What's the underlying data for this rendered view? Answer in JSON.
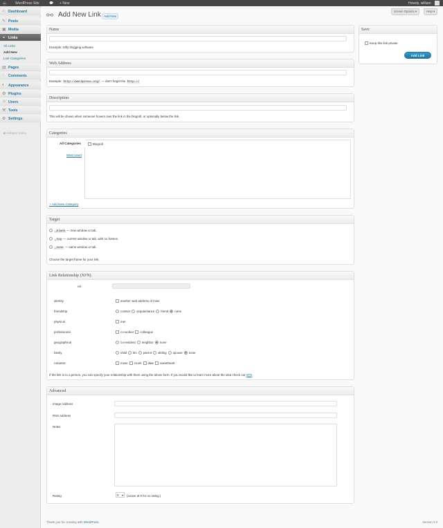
{
  "admin_bar": {
    "site_name": "WordPress Site",
    "comments_count": "",
    "new_label": "New",
    "howdy": "Howdy, william"
  },
  "sidebar": {
    "items": [
      {
        "label": "Dashboard"
      },
      {
        "label": "Posts"
      },
      {
        "label": "Media"
      },
      {
        "label": "Links"
      },
      {
        "label": "Pages"
      },
      {
        "label": "Comments"
      },
      {
        "label": "Appearance"
      },
      {
        "label": "Plugins"
      },
      {
        "label": "Users"
      },
      {
        "label": "Tools"
      },
      {
        "label": "Settings"
      }
    ],
    "links_sub": [
      "All Links",
      "Add New",
      "Link Categories"
    ],
    "collapse": "Collapse menu"
  },
  "header": {
    "title": "Add New Link",
    "add_new": "Add New",
    "screen_options": "Screen Options",
    "help": "Help"
  },
  "name_box": {
    "title": "Name",
    "value": "",
    "hint": "Example: Nifty blogging software"
  },
  "web_box": {
    "title": "Web Address",
    "value": "",
    "hint_pre": "Example:",
    "hint_code1": "http://wordpress.org/",
    "hint_mid": "— don't forget the",
    "hint_code2": "http://"
  },
  "desc_box": {
    "title": "Description",
    "value": "",
    "hint": "This will be shown when someone hovers over the link in the blogroll, or optionally below the link."
  },
  "categories": {
    "title": "Categories",
    "tab_all": "All Categories",
    "tab_most": "Most Used",
    "item": "Blogroll",
    "add": "+ Add New Category"
  },
  "target": {
    "title": "Target",
    "options": [
      {
        "code": "_blank",
        "text": "— new window or tab."
      },
      {
        "code": "_top",
        "text": "— current window or tab, with no frames."
      },
      {
        "code": "_none",
        "text": "— same window or tab."
      }
    ],
    "hint": "Choose the target frame for your link."
  },
  "xfn": {
    "title": "Link Relationship (XFN)",
    "rel_label": "rel:",
    "rel_value": "",
    "rows": [
      {
        "label": "identity",
        "opts": [
          {
            "t": "another web address of mine",
            "k": "cb"
          }
        ]
      },
      {
        "label": "friendship",
        "opts": [
          {
            "t": "contact",
            "k": "rd"
          },
          {
            "t": "acquaintance",
            "k": "rd"
          },
          {
            "t": "friend",
            "k": "rd"
          },
          {
            "t": "none",
            "k": "rd",
            "on": true
          }
        ]
      },
      {
        "label": "physical",
        "opts": [
          {
            "t": "met",
            "k": "cb"
          }
        ]
      },
      {
        "label": "professional",
        "opts": [
          {
            "t": "co-worker",
            "k": "cb"
          },
          {
            "t": "colleague",
            "k": "cb"
          }
        ]
      },
      {
        "label": "geographical",
        "opts": [
          {
            "t": "co-resident",
            "k": "rd"
          },
          {
            "t": "neighbor",
            "k": "rd"
          },
          {
            "t": "none",
            "k": "rd",
            "on": true
          }
        ]
      },
      {
        "label": "family",
        "opts": [
          {
            "t": "child",
            "k": "rd"
          },
          {
            "t": "kin",
            "k": "rd"
          },
          {
            "t": "parent",
            "k": "rd"
          },
          {
            "t": "sibling",
            "k": "rd"
          },
          {
            "t": "spouse",
            "k": "rd"
          },
          {
            "t": "none",
            "k": "rd",
            "on": true
          }
        ]
      },
      {
        "label": "romantic",
        "opts": [
          {
            "t": "muse",
            "k": "cb"
          },
          {
            "t": "crush",
            "k": "cb"
          },
          {
            "t": "date",
            "k": "cb"
          },
          {
            "t": "sweetheart",
            "k": "cb"
          }
        ]
      }
    ],
    "footer_text": "If the link is to a person, you can specify your relationship with them using the above form. If you would like to learn more about the idea check out",
    "footer_link": "XFN"
  },
  "advanced": {
    "title": "Advanced",
    "image_label": "Image Address",
    "rss_label": "RSS Address",
    "notes_label": "Notes",
    "rating_label": "Rating",
    "rating_value": "0",
    "rating_hint": "(Leave at 0 for no rating.)"
  },
  "save": {
    "title": "Save",
    "private": "Keep this link private",
    "button": "Add Link"
  },
  "footer": {
    "thanks": "Thank you for creating with",
    "wp": "WordPress",
    "version": "Version 3.3"
  }
}
